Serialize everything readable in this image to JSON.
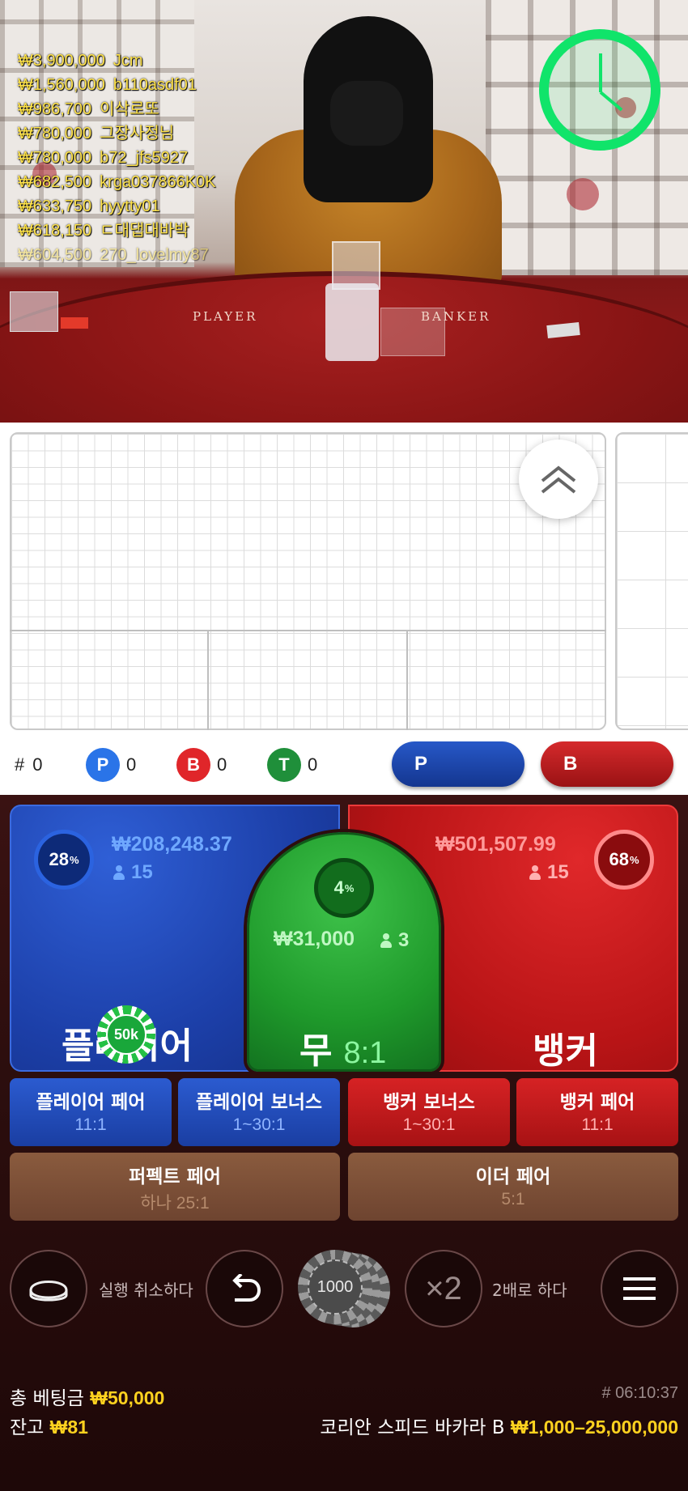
{
  "video": {
    "table_labels": {
      "player": "PLAYER",
      "banker": "BANKER"
    },
    "winners": [
      {
        "amount": "₩3,900,000",
        "name": "Jcm"
      },
      {
        "amount": "₩1,560,000",
        "name": "b110asdf01"
      },
      {
        "amount": "₩986,700",
        "name": "이삭로또"
      },
      {
        "amount": "₩780,000",
        "name": "그장사정님"
      },
      {
        "amount": "₩780,000",
        "name": "b72_jfs5927"
      },
      {
        "amount": "₩682,500",
        "name": "krga037866K0K"
      },
      {
        "amount": "₩633,750",
        "name": "hyytty01"
      },
      {
        "amount": "₩618,150",
        "name": "ㄷ대댑대바박"
      },
      {
        "amount": "₩604,500",
        "name": "270_lovelmy87"
      }
    ],
    "timer_color": "#10e46a"
  },
  "roadmap": {
    "stats": {
      "hash_label": "#",
      "hash_count": "0",
      "p_label": "P",
      "p_count": "0",
      "b_label": "B",
      "b_count": "0",
      "t_label": "T",
      "t_count": "0"
    },
    "predict_player": "P",
    "predict_banker": "B",
    "colors": {
      "player": "#1f5ee0",
      "banker": "#e0262a",
      "tie": "#1f8f3a"
    }
  },
  "bets": {
    "player": {
      "percent": "28",
      "amount": "₩208,248.37",
      "count": "15",
      "label": "플레이어"
    },
    "tie": {
      "percent": "4",
      "amount": "₩31,000",
      "count": "3",
      "label": "무",
      "odds": "8:1"
    },
    "banker": {
      "percent": "68",
      "amount": "₩501,507.99",
      "count": "15",
      "label": "뱅커"
    },
    "placed_chip": "50k",
    "side_bets": [
      {
        "title": "플레이어 페어",
        "odds": "11:1"
      },
      {
        "title": "플레이어 보너스",
        "odds": "1~30:1"
      },
      {
        "title": "뱅커 보너스",
        "odds": "1~30:1"
      },
      {
        "title": "뱅커 페어",
        "odds": "11:1"
      }
    ],
    "perfect_pair": {
      "title": "퍼펙트 페어",
      "odds": "하나 25:1"
    },
    "either_pair": {
      "title": "이더 페어",
      "odds": "5:1"
    }
  },
  "controls": {
    "undo_label": "실행 취소하다",
    "chip_value": "1000",
    "double_symbol": "×2",
    "double_label": "2배로 하다"
  },
  "footer": {
    "total_bet_label": "총 베팅금",
    "total_bet_value": "₩50,000",
    "balance_label": "잔고",
    "balance_value": "₩81",
    "game_id": "# 06:10:37",
    "table_name": "코리안 스피드 바카라 B",
    "limits": "₩1,000–25,000,000"
  }
}
